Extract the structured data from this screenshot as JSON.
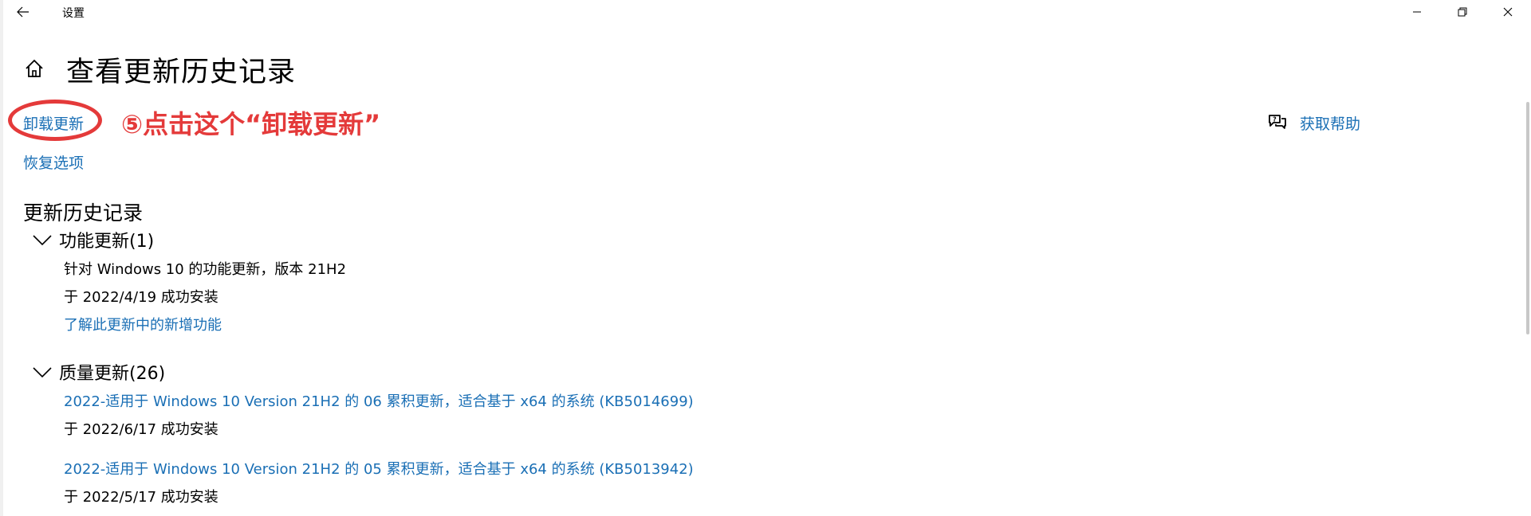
{
  "window": {
    "title": "设置"
  },
  "header": {
    "page_title": "查看更新历史记录"
  },
  "links": {
    "uninstall_updates": "卸载更新",
    "recovery_options": "恢复选项",
    "get_help": "获取帮助"
  },
  "annotation": {
    "text": "⑤点击这个“卸载更新”",
    "color": "#e43a3a"
  },
  "history": {
    "title": "更新历史记录",
    "groups": [
      {
        "label": "功能更新(1)",
        "items": [
          {
            "name": "针对 Windows 10 的功能更新，版本 21H2",
            "status": "于 2022/4/19 成功安装",
            "link": "了解此更新中的新增功能"
          }
        ]
      },
      {
        "label": "质量更新(26)",
        "items": [
          {
            "name": "2022-适用于 Windows 10 Version 21H2 的 06 累积更新，适合基于 x64 的系统 (KB5014699)",
            "status": "于 2022/6/17 成功安装"
          },
          {
            "name": "2022-适用于 Windows 10 Version 21H2 的 05 累积更新，适合基于 x64 的系统 (KB5013942)",
            "status": "于 2022/5/17 成功安装"
          }
        ]
      }
    ]
  },
  "colors": {
    "link": "#1a6fb5",
    "text": "#000000",
    "background": "#ffffff"
  },
  "icons": {
    "back": "back-arrow-icon",
    "minimize": "minimize-icon",
    "restore": "restore-icon",
    "close": "close-icon",
    "home": "home-icon",
    "help": "chat-help-icon",
    "expand": "chevron-down-icon"
  }
}
